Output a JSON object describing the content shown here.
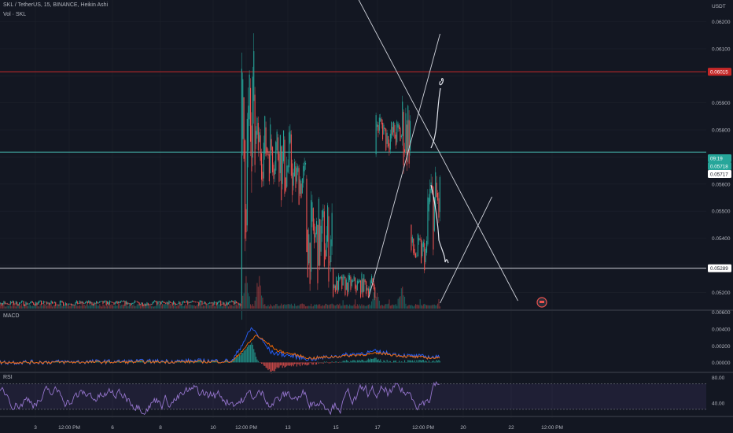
{
  "header": {
    "symbol_line": "SKL / TetherUS, 15, BINANCE, Heikin Ashi",
    "volume_line": "Vol · SKL"
  },
  "colors": {
    "background": "#131722",
    "up": "#26a69a",
    "down": "#ef5350",
    "grid": "#1e222d",
    "resistance": "#c62828",
    "current_price": "#4dd0c4",
    "support": "#d1d4dc",
    "drawing": "#d1d4dc",
    "macd": "#2962ff",
    "signal": "#ff6d00",
    "rsi": "#7e57c2"
  },
  "chart_data": [
    {
      "type": "candlestick",
      "pane": "price",
      "symbol": "SKL / TetherUS",
      "timeframe": "15",
      "exchange": "BINANCE",
      "style": "Heikin Ashi",
      "axis_unit": "USDT",
      "y_ticks": [
        0.062,
        0.061,
        0.06,
        0.059,
        0.058,
        0.057,
        0.056,
        0.055,
        0.054,
        0.053,
        0.052
      ],
      "y_tick_labels": [
        "0.06200",
        "0.06100",
        "",
        "0.05900",
        "0.05800",
        "",
        "0.05600",
        "0.05500",
        "0.05400",
        "",
        "0.05200"
      ],
      "ylim": [
        0.05137,
        0.0628
      ],
      "x_tick_labels": [
        "3",
        "12:00 PM",
        "6",
        "8",
        "10",
        "12:00 PM",
        "13",
        "15",
        "17",
        "12:00 PM",
        "20",
        "22",
        "12:00 PM"
      ],
      "price_labels": [
        {
          "name": "resistance",
          "value": 0.06015,
          "label": "0.06015"
        },
        {
          "name": "countdown",
          "value": 0.0576,
          "label": "09:19"
        },
        {
          "name": "last",
          "value": 0.05718,
          "label": "0.05718"
        },
        {
          "name": "close",
          "value": 0.05717,
          "label": "0.05717"
        },
        {
          "name": "support",
          "value": 0.05289,
          "label": "0.05289"
        }
      ],
      "horizontal_lines": [
        {
          "name": "resistance",
          "value": 0.06015
        },
        {
          "name": "current",
          "value": 0.05718
        },
        {
          "name": "support",
          "value": 0.05289
        }
      ],
      "trendlines": [
        {
          "name": "descending",
          "from": [
            "2020-12-15 00:00",
            0.06347
          ],
          "to": [
            "2020-12-21 12:00",
            0.05169
          ]
        },
        {
          "name": "ascending-main",
          "from": [
            "2020-12-15 18:00",
            0.0518
          ],
          "to": [
            "2020-12-18 12:00",
            0.06155
          ]
        },
        {
          "name": "ascending-lower",
          "from": [
            "2020-12-18 12:00",
            0.0516
          ],
          "to": [
            "2020-12-20 12:00",
            0.05553
          ]
        }
      ],
      "series": [
        {
          "name": "SKL",
          "segments": [
            {
              "start": "2020-12-01 00:00",
              "end": "2020-12-10 20:00",
              "low": 0.05145,
              "high": 0.05175
            },
            {
              "start": "2020-12-10 20:00",
              "end": "2020-12-11 08:00",
              "low": 0.0516,
              "high": 0.0628
            },
            {
              "start": "2020-12-11 08:00",
              "end": "2020-12-12 08:00",
              "low": 0.0555,
              "high": 0.0593
            },
            {
              "start": "2020-12-12 08:00",
              "end": "2020-12-12 20:00",
              "low": 0.0545,
              "high": 0.0588
            },
            {
              "start": "2020-12-12 20:00",
              "end": "2020-12-13 08:00",
              "low": 0.0548,
              "high": 0.0575
            },
            {
              "start": "2020-12-13 08:00",
              "end": "2020-12-14 08:00",
              "low": 0.0516,
              "high": 0.0562
            },
            {
              "start": "2020-12-14 08:00",
              "end": "2020-12-16 00:00",
              "low": 0.0516,
              "high": 0.0529
            },
            {
              "start": "2020-12-16 00:00",
              "end": "2020-12-16 08:00",
              "low": 0.0571,
              "high": 0.0592
            },
            {
              "start": "2020-12-16 08:00",
              "end": "2020-12-17 00:00",
              "low": 0.0568,
              "high": 0.0588
            },
            {
              "start": "2020-12-17 00:00",
              "end": "2020-12-17 08:00",
              "low": 0.0555,
              "high": 0.0605
            },
            {
              "start": "2020-12-17 08:00",
              "end": "2020-12-18 00:00",
              "low": 0.0524,
              "high": 0.0545
            },
            {
              "start": "2020-12-18 00:00",
              "end": "2020-12-18 12:00",
              "low": 0.0528,
              "high": 0.0576
            }
          ]
        }
      ]
    },
    {
      "type": "bar",
      "pane": "volume",
      "title": "Vol · SKL",
      "bar_labels": [],
      "series": [
        {
          "name": "Vol · SKL",
          "peaks": [
            {
              "at": "2020-12-11 00:00",
              "relative": 0.35
            },
            {
              "at": "2020-12-11 12:00",
              "relative": 0.45
            },
            {
              "at": "2020-12-16 00:00",
              "relative": 0.2
            },
            {
              "at": "2020-12-17 00:00",
              "relative": 0.25
            }
          ]
        }
      ]
    },
    {
      "type": "line",
      "pane": "macd",
      "title": "MACD",
      "y_ticks": [
        0.004,
        0.002,
        0.0
      ],
      "y_tick_labels": [
        "0.00400",
        "0.00200",
        "0.00000"
      ],
      "extra_top_label": "0.00600",
      "ylim": [
        -0.0011,
        0.0062
      ],
      "series": [
        {
          "name": "MACD",
          "points": [
            [
              "2020-12-01 00:00",
              0.0
            ],
            [
              "2020-12-10 12:00",
              0.0002
            ],
            [
              "2020-12-11 06:00",
              0.0042
            ],
            [
              "2020-12-12 00:00",
              0.0012
            ],
            [
              "2020-12-13 12:00",
              0.0004
            ],
            [
              "2020-12-16 00:00",
              0.0013
            ],
            [
              "2020-12-17 06:00",
              0.0008
            ],
            [
              "2020-12-18 12:00",
              0.0006
            ]
          ]
        },
        {
          "name": "Signal",
          "points": [
            [
              "2020-12-01 00:00",
              0.0
            ],
            [
              "2020-12-10 12:00",
              0.0001
            ],
            [
              "2020-12-11 10:00",
              0.0033
            ],
            [
              "2020-12-12 06:00",
              0.0014
            ],
            [
              "2020-12-13 12:00",
              0.0005
            ],
            [
              "2020-12-16 06:00",
              0.0011
            ],
            [
              "2020-12-17 06:00",
              0.0007
            ],
            [
              "2020-12-18 12:00",
              0.0005
            ]
          ]
        }
      ]
    },
    {
      "type": "line",
      "pane": "rsi",
      "title": "RSI",
      "y_ticks": [
        80,
        40
      ],
      "y_tick_labels": [
        "80.00",
        "40.00"
      ],
      "ylim": [
        20,
        87
      ],
      "band": [
        30,
        70
      ],
      "series": [
        {
          "name": "RSI",
          "range": [
            22,
            80
          ],
          "last": 75
        }
      ]
    }
  ]
}
